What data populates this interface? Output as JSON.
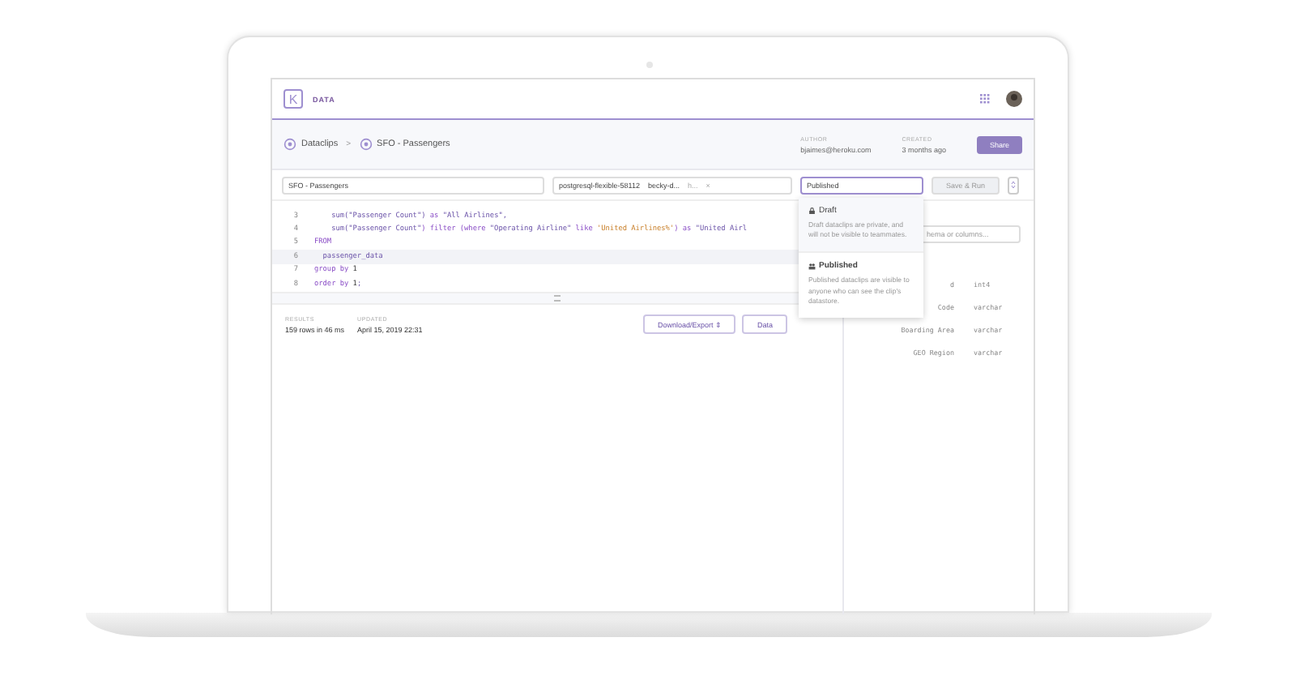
{
  "header": {
    "logo": "K",
    "app_name": "DATA"
  },
  "breadcrumb": {
    "items": [
      {
        "label": "Dataclips"
      },
      {
        "label": "SFO - Passengers"
      }
    ],
    "separator": ">"
  },
  "meta": [
    {
      "label": "AUTHOR",
      "value": "bjaimes@heroku.com"
    },
    {
      "label": "CREATED",
      "value": "3 months ago"
    }
  ],
  "share_button": "Share",
  "toolbar": {
    "title_value": "SFO - Passengers",
    "datasource": "postgresql-flexible-58112",
    "attachment": "becky-d...",
    "extra": "h...",
    "clear": "×",
    "visibility": "Published",
    "run_button": {
      "label": "Save & Run",
      "disabled": true
    }
  },
  "code": [
    {
      "number": "3",
      "current": false,
      "tokens": [
        {
          "t": "    sum(",
          "kind": "fn"
        },
        {
          "t": "\"Passenger Count\"",
          "kind": "plain"
        },
        {
          "t": ") ",
          "kind": "fn"
        },
        {
          "t": "as",
          "kind": "kw"
        },
        {
          "t": " \"All Airlines\",",
          "kind": "plain"
        }
      ]
    },
    {
      "number": "4",
      "current": false,
      "tokens": [
        {
          "t": "    sum(",
          "kind": "fn"
        },
        {
          "t": "\"Passenger Count\"",
          "kind": "plain"
        },
        {
          "t": ") filter (where ",
          "kind": "kw"
        },
        {
          "t": "\"Operating Airline\" ",
          "kind": "plain"
        },
        {
          "t": "like ",
          "kind": "kw"
        },
        {
          "t": "'United Airlines%'",
          "kind": "str"
        },
        {
          "t": ") as ",
          "kind": "kw"
        },
        {
          "t": "\"United Airl",
          "kind": "plain"
        }
      ]
    },
    {
      "number": "5",
      "current": false,
      "tokens": [
        {
          "t": "FROM",
          "kind": "kw"
        }
      ]
    },
    {
      "number": "6",
      "current": true,
      "tokens": [
        {
          "t": "  passenger_data",
          "kind": "plain"
        }
      ]
    },
    {
      "number": "7",
      "current": false,
      "tokens": [
        {
          "t": "group by ",
          "kind": "kw"
        },
        {
          "t": "1",
          "kind": "num"
        }
      ]
    },
    {
      "number": "8",
      "current": false,
      "tokens": [
        {
          "t": "order by ",
          "kind": "kw"
        },
        {
          "t": "1",
          "kind": "num"
        },
        {
          "t": ";",
          "kind": "plain"
        }
      ]
    }
  ],
  "results": [
    {
      "label": "RESULTS",
      "value": "159 rows in 46 ms"
    },
    {
      "label": "UPDATED",
      "value": "April 15, 2019 22:31"
    }
  ],
  "result_buttons": [
    {
      "label": "Download/Export ⇕"
    },
    {
      "label": "Data"
    }
  ],
  "schema": {
    "search_placeholder": "hema or columns...",
    "rows": [
      {
        "name": "d",
        "type": "int4"
      },
      {
        "name": "Code",
        "type": "varchar"
      },
      {
        "name": "Boarding Area",
        "type": "varchar"
      },
      {
        "name": "GEO Region",
        "type": "varchar"
      }
    ]
  },
  "visibility_menu": [
    {
      "title": "Draft",
      "kind": "lock",
      "selected": false,
      "description": "Draft dataclips are private, and will not be visible to teammates."
    },
    {
      "title": "Published",
      "kind": "people",
      "selected": true,
      "description": "Published dataclips are visible to anyone who can see the clip's datastore."
    }
  ]
}
